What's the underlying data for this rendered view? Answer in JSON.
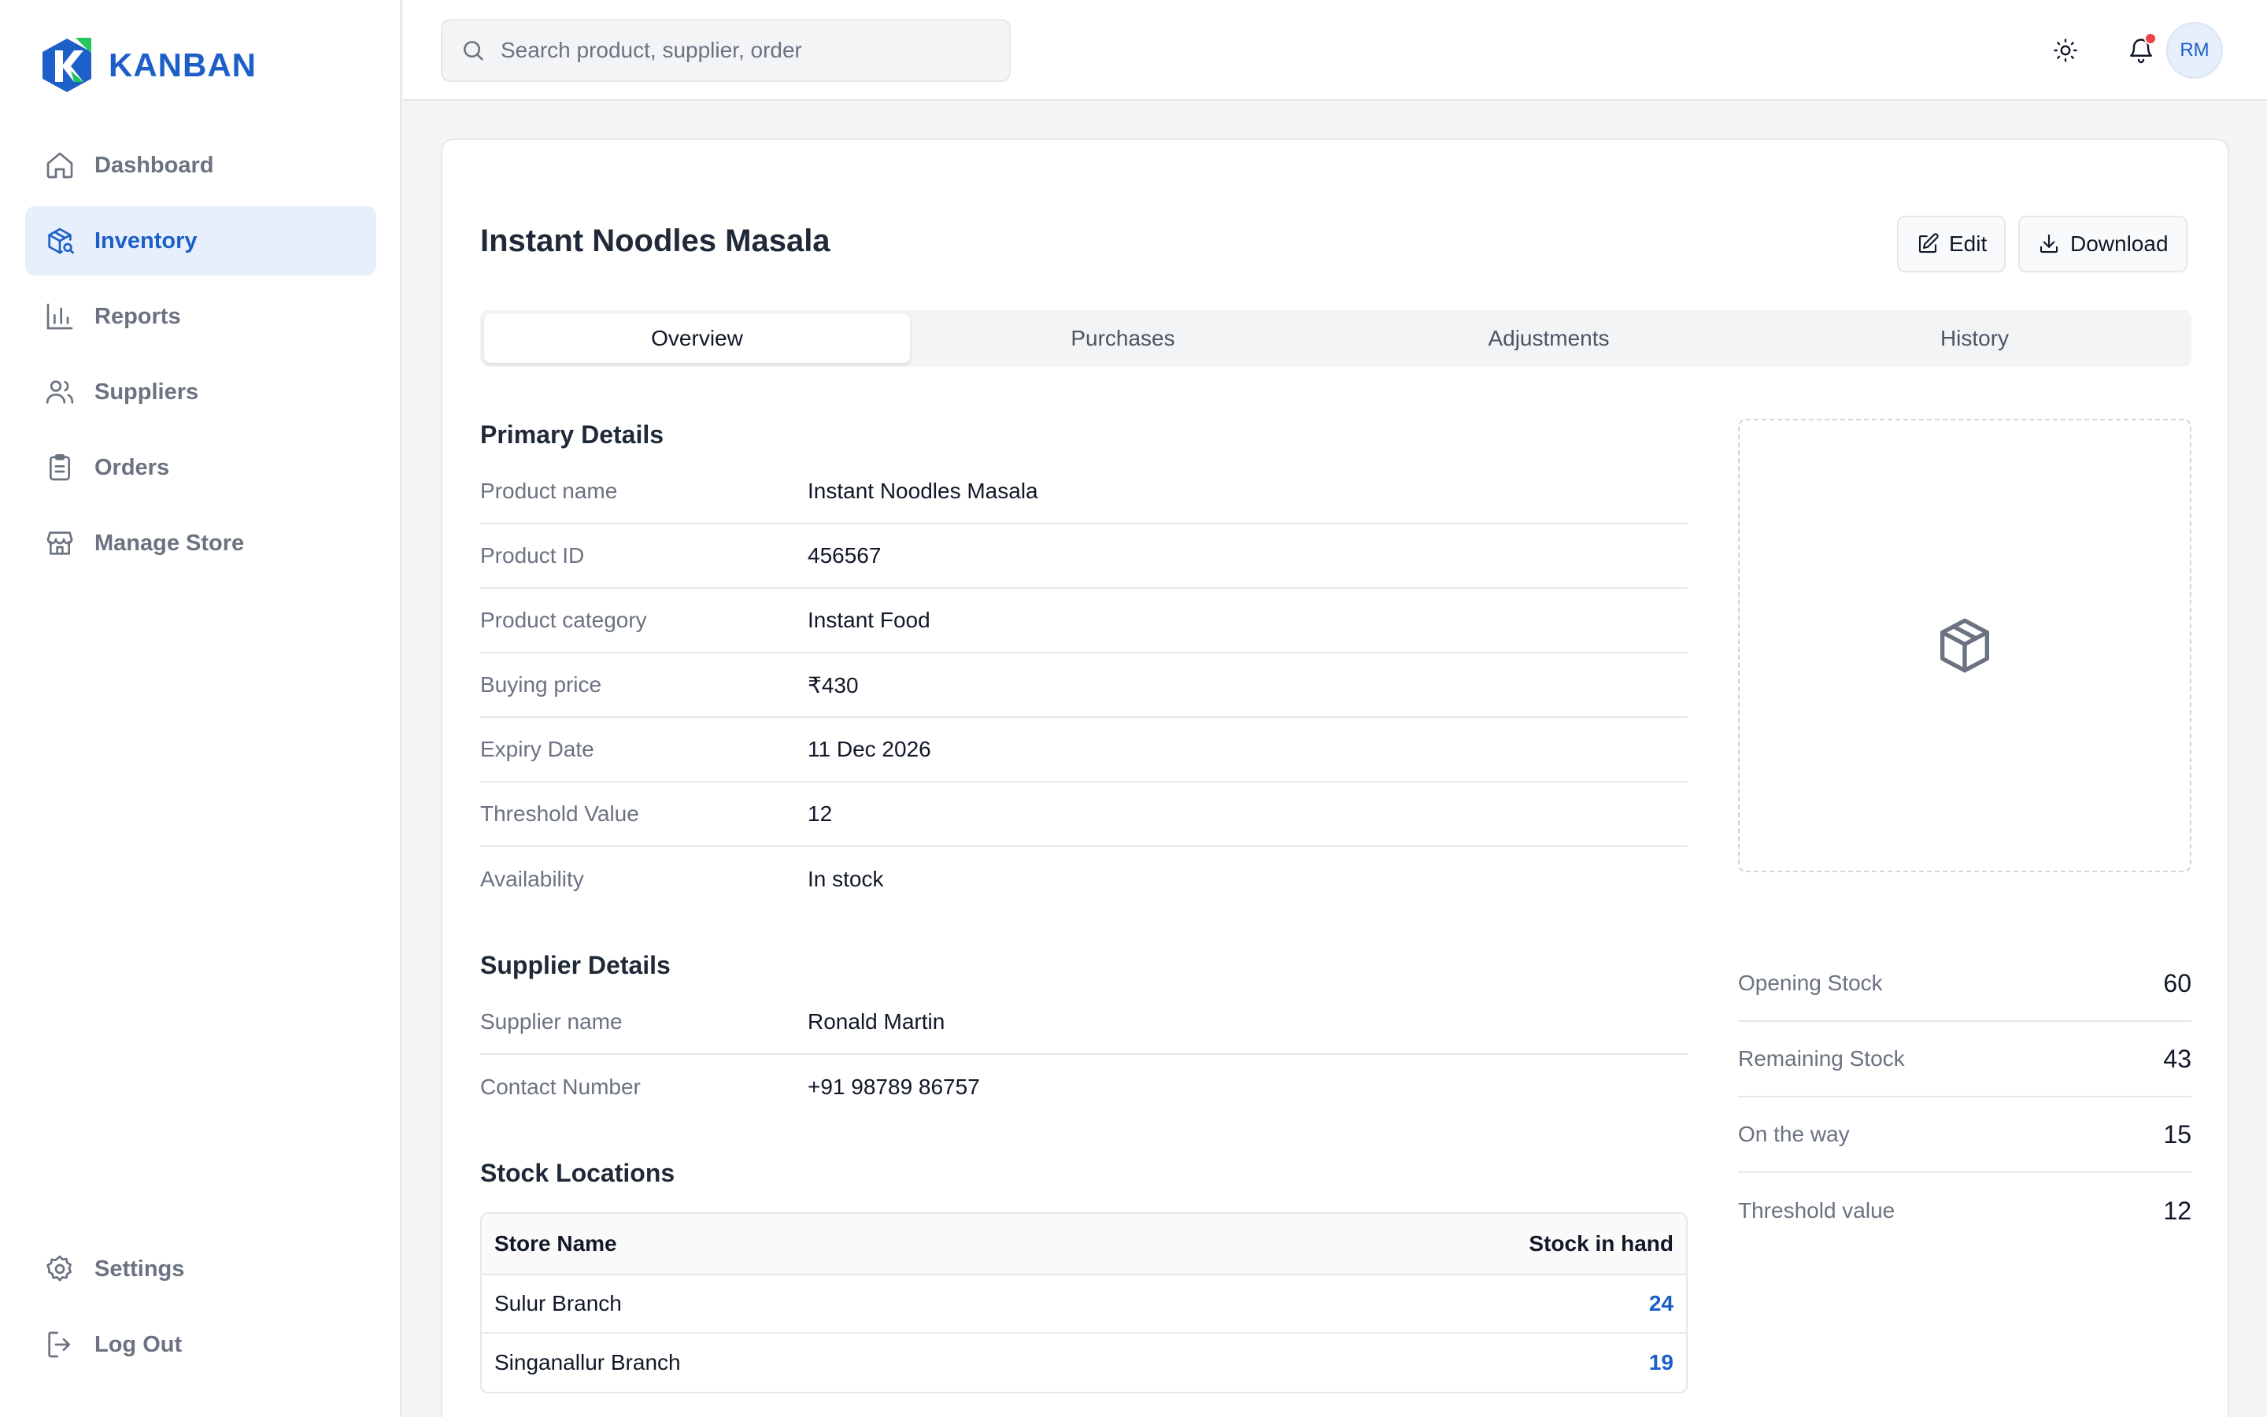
{
  "brand": {
    "name": "KANBAN",
    "accent": "#1d5fc8"
  },
  "sidebar": {
    "items": [
      {
        "label": "Dashboard",
        "icon": "home-icon"
      },
      {
        "label": "Inventory",
        "icon": "package-search-icon",
        "active": true
      },
      {
        "label": "Reports",
        "icon": "bar-chart-icon"
      },
      {
        "label": "Suppliers",
        "icon": "users-icon"
      },
      {
        "label": "Orders",
        "icon": "clipboard-icon"
      },
      {
        "label": "Manage Store",
        "icon": "store-icon"
      }
    ],
    "bottom": [
      {
        "label": "Settings",
        "icon": "gear-icon"
      },
      {
        "label": "Log Out",
        "icon": "logout-icon"
      }
    ]
  },
  "header": {
    "search_placeholder": "Search product, supplier, order",
    "avatar_initials": "RM"
  },
  "product": {
    "title": "Instant Noodles Masala",
    "edit_label": "Edit",
    "download_label": "Download",
    "tabs": [
      "Overview",
      "Purchases",
      "Adjustments",
      "History"
    ],
    "active_tab": "Overview"
  },
  "primary": {
    "title": "Primary Details",
    "rows": [
      {
        "label": "Product name",
        "value": "Instant Noodles Masala"
      },
      {
        "label": "Product ID",
        "value": "456567"
      },
      {
        "label": "Product category",
        "value": "Instant Food"
      },
      {
        "label": "Buying price",
        "value": "₹430"
      },
      {
        "label": "Expiry Date",
        "value": "11 Dec 2026"
      },
      {
        "label": "Threshold Value",
        "value": "12"
      },
      {
        "label": "Availability",
        "value": "In stock"
      }
    ]
  },
  "supplier": {
    "title": "Supplier Details",
    "rows": [
      {
        "label": "Supplier name",
        "value": "Ronald Martin"
      },
      {
        "label": "Contact Number",
        "value": "+91 98789 86757"
      }
    ]
  },
  "stock_locations": {
    "title": "Stock Locations",
    "headers": [
      "Store Name",
      "Stock in hand"
    ],
    "rows": [
      {
        "store": "Sulur Branch",
        "stock": "24"
      },
      {
        "store": "Singanallur Branch",
        "stock": "19"
      }
    ]
  },
  "stats": [
    {
      "label": "Opening Stock",
      "value": "60"
    },
    {
      "label": "Remaining Stock",
      "value": "43"
    },
    {
      "label": "On the way",
      "value": "15"
    },
    {
      "label": "Threshold value",
      "value": "12"
    }
  ],
  "image_placeholder_icon": "box-icon"
}
